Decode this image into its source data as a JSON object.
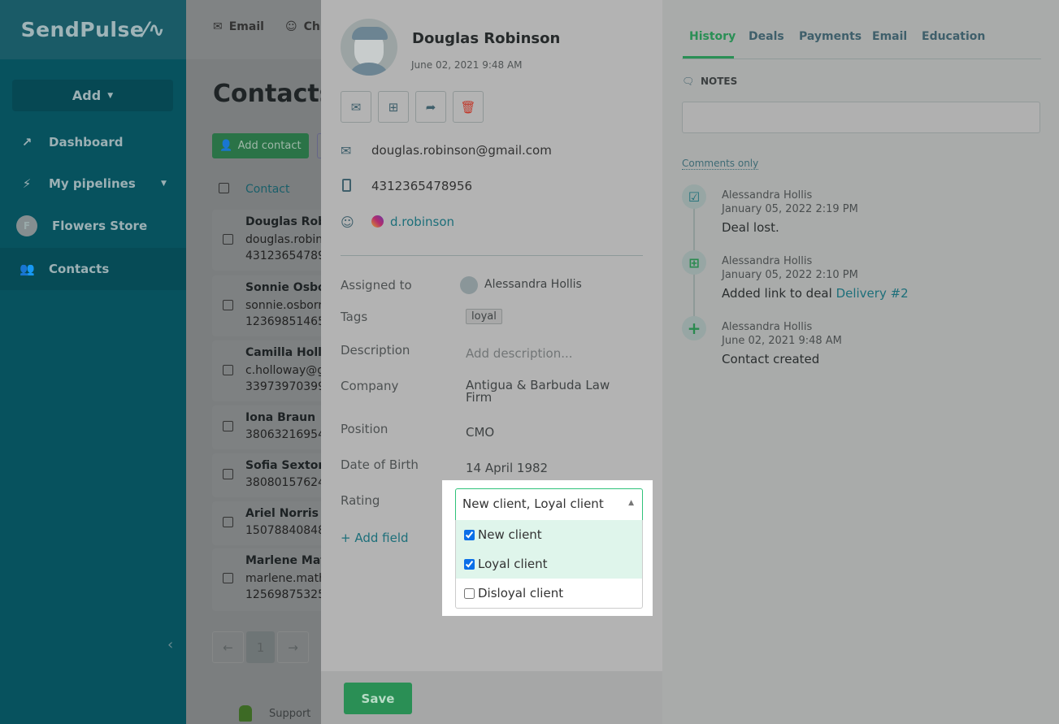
{
  "sidebar": {
    "logo": "SendPulse",
    "add": "Add",
    "items": [
      {
        "label": "Dashboard",
        "icon": "chart-icon"
      },
      {
        "label": "My pipelines",
        "icon": "pipeline-icon"
      },
      {
        "label": "Flowers Store",
        "icon": "avatar-icon",
        "avatar": "F"
      },
      {
        "label": "Contacts",
        "icon": "contacts-icon"
      }
    ]
  },
  "topnav": {
    "email": "Email",
    "chat": "Ch"
  },
  "contacts": {
    "title": "Contacts",
    "add_contact": "Add contact",
    "column": "Contact",
    "rows": [
      {
        "name": "Douglas Robi",
        "line1": "douglas.robins",
        "line2": "43123654789"
      },
      {
        "name": "Sonnie Osbor",
        "line1": "sonnie.osborn",
        "line2": "12369851465"
      },
      {
        "name": "Camilla Hollo",
        "line1": "c.holloway@g",
        "line2": "33973970399"
      },
      {
        "name": "Iona Braun",
        "line1": "38063216954"
      },
      {
        "name": "Sofia Sexton",
        "line1": "38080157624"
      },
      {
        "name": "Ariel Norris",
        "line1": "15078840848"
      },
      {
        "name": "Marlene Math",
        "line1": "marlene.mathi",
        "line2": "12569875325"
      }
    ],
    "pagination": {
      "prev": "←",
      "page": "1",
      "next": "→"
    },
    "footer": {
      "support": "Support"
    }
  },
  "detail": {
    "name": "Douglas Robinson",
    "created": "June 02, 2021 9:48 AM",
    "email": "douglas.robinson@gmail.com",
    "phone": "4312365478956",
    "instagram": "d.robinson",
    "fields": {
      "assigned_label": "Assigned to",
      "assigned": "Alessandra Hollis",
      "tags_label": "Tags",
      "tag": "loyal",
      "description_label": "Description",
      "description_placeholder": "Add description...",
      "company_label": "Company",
      "company": "Antigua & Barbuda Law Firm",
      "position_label": "Position",
      "position": "CMO",
      "dob_label": "Date of Birth",
      "dob": "14 April 1982",
      "rating_label": "Rating",
      "rating_value": "New client, Loyal client",
      "add_field": "+ Add field"
    },
    "rating_options": [
      {
        "label": "New client",
        "checked": true
      },
      {
        "label": "Loyal client",
        "checked": true
      },
      {
        "label": "Disloyal client",
        "checked": false
      }
    ],
    "save": "Save"
  },
  "right": {
    "tabs": [
      "History",
      "Deals",
      "Payments",
      "Email",
      "Education"
    ],
    "active_tab": "History",
    "notes": "NOTES",
    "filter": "Comments only",
    "history": [
      {
        "who": "Alessandra Hollis",
        "when": "January 05, 2022 2:19 PM",
        "msg": "Deal lost."
      },
      {
        "who": "Alessandra Hollis",
        "when": "January 05, 2022 2:10 PM",
        "msg": "Added link to deal ",
        "link": "Delivery #2"
      },
      {
        "who": "Alessandra Hollis",
        "when": "June 02, 2021 9:48 AM",
        "msg": "Contact created"
      }
    ]
  },
  "colors": {
    "accent": "#2a8f55",
    "link": "#1a7f8a"
  }
}
